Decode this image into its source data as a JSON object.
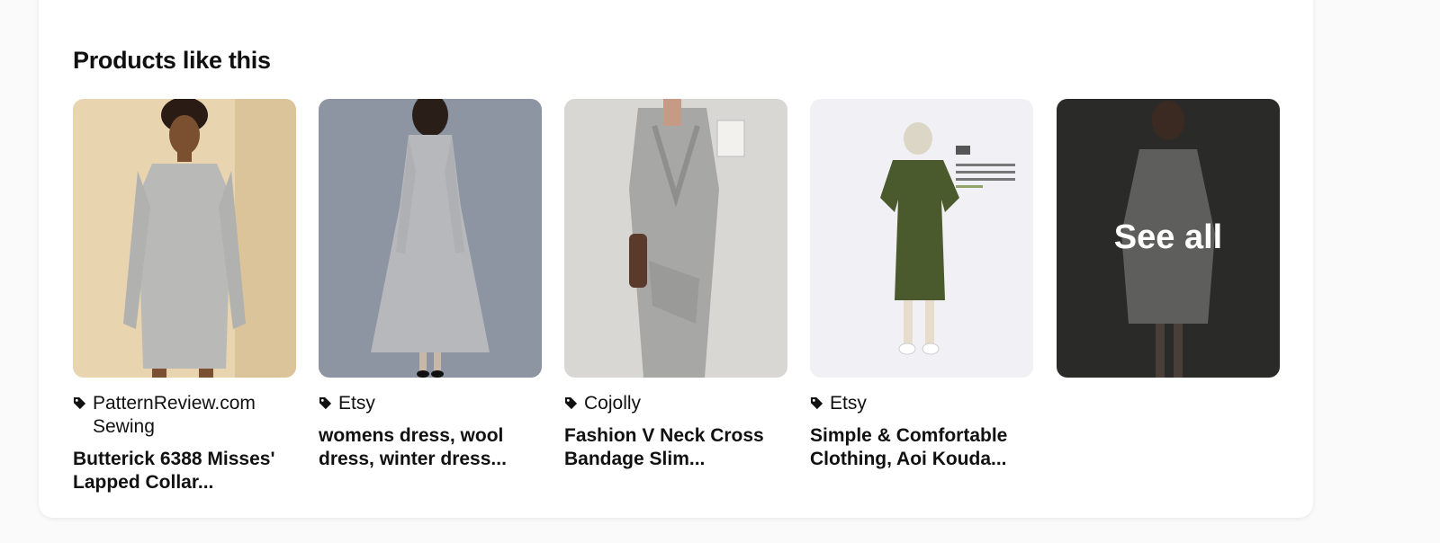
{
  "section": {
    "title": "Products like this"
  },
  "products": [
    {
      "source": "PatternReview.com Sewing",
      "name": "Butterick 6388 Misses' Lapped Collar...",
      "image": "woman-in-gray-knit-dress"
    },
    {
      "source": "Etsy",
      "name": "womens dress, wool dress, winter dress...",
      "image": "gray-wool-dress-back-view"
    },
    {
      "source": "Cojolly",
      "name": "Fashion V Neck Cross Bandage Slim...",
      "image": "gray-wrap-knit-dress-mirror-selfie"
    },
    {
      "source": "Etsy",
      "name": "Simple & Comfortable Clothing, Aoi Kouda...",
      "image": "green-wrap-dress-pattern-book"
    }
  ],
  "see_all": {
    "label": "See all",
    "image": "white-chiffon-dress-dark-overlay"
  },
  "colors": {
    "card": "#ffffff",
    "text": "#111111",
    "overlay": "#1e1e1e"
  }
}
